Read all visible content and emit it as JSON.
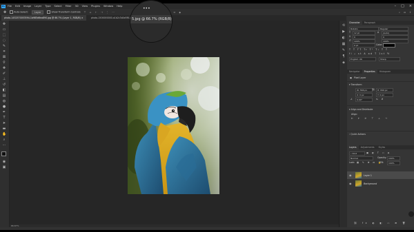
{
  "menubar": {
    "logo": "Ps",
    "items": [
      "File",
      "Edit",
      "Image",
      "Layer",
      "Type",
      "Select",
      "Filter",
      "3D",
      "View",
      "Plugins",
      "Window",
      "Help"
    ]
  },
  "options_bar": {
    "auto_select_label": "Auto-Select:",
    "auto_select_value": "Layer",
    "show_transform_label": "Show Transform Controls"
  },
  "tabs": {
    "tab1": "photo-1452570053594-1b985d6ea890.jpg @ 66.7% (Layer 1, RGB/8)",
    "tab2": "photo-1500000000-a1b2c3d4e5f6.jpg @ 66.7% (Layer 1, RGB/8)"
  },
  "zoom_bubble": {
    "dots": "•••",
    "text": "5.jpg @ 66.7% (RGB/8)"
  },
  "status_bar": {
    "zoom": "66.67%"
  },
  "right_panels": {
    "character": {
      "tabs": [
        "Character",
        "Paragraph"
      ],
      "font_family": "Roboto",
      "font_style": "Regular",
      "size": "12 pt",
      "leading": "(Auto)",
      "tracking": "0",
      "scale_v": "100%",
      "scale_h": "100%",
      "baseline": "0 pt",
      "color_label": "Color:",
      "language": "English: UK",
      "aa": "Sharp"
    },
    "properties": {
      "tabs": [
        "Navigator",
        "Properties",
        "Histogram"
      ],
      "type": "Pixel Layer",
      "transform_label": "Transform",
      "w": "W: 566 px",
      "h": "H: 849 px",
      "x": "X: 0 px",
      "y": "Y: 0 px",
      "angle": "0.00°",
      "align_label": "Align and Distribute",
      "align_sub": "Align:",
      "quick_actions": "Quick Actions"
    },
    "layers": {
      "tabs": [
        "Layers",
        "Adjustments",
        "Styles"
      ],
      "kind": "Kind",
      "blend_mode": "Normal",
      "opacity_label": "Opacity:",
      "opacity": "100%",
      "lock_label": "Lock:",
      "fill_label": "Fill:",
      "fill": "100%",
      "items": [
        {
          "name": "Layer 1",
          "selected": true
        },
        {
          "name": "Background",
          "selected": false
        }
      ]
    }
  },
  "colors": {
    "bg": "#323232",
    "canvas": "#262626",
    "accent": "#31a8ff"
  }
}
